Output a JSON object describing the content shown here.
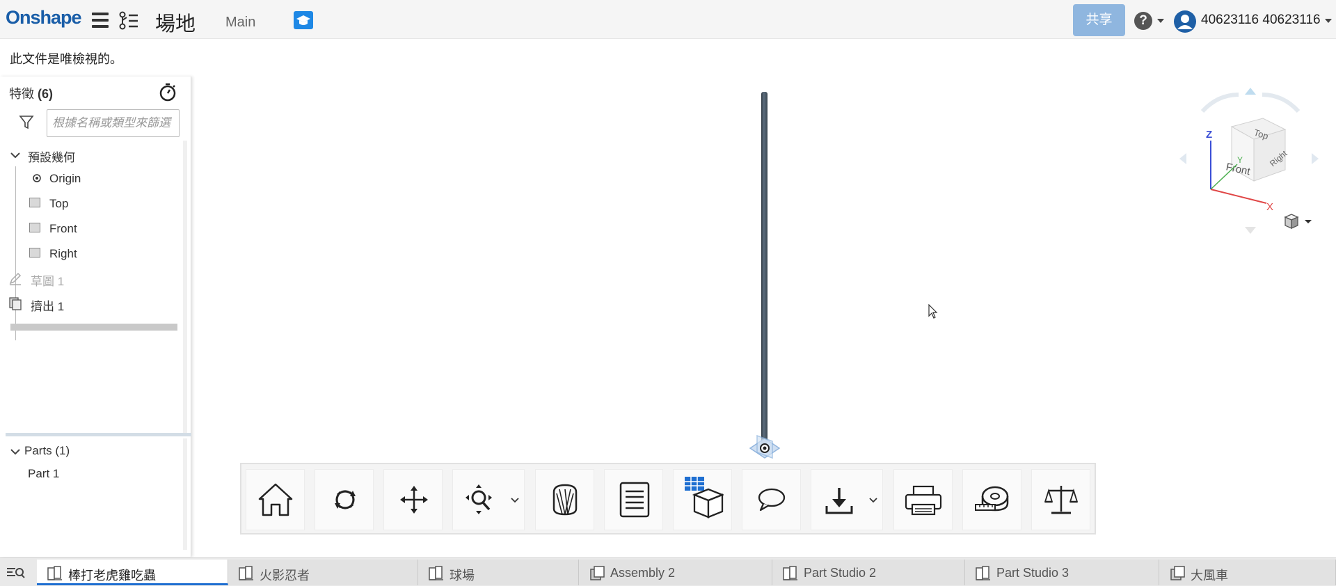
{
  "app": {
    "logo": "Onshape",
    "document_title": "場地",
    "branch": "Main",
    "share_label": "共享",
    "help_label": "?",
    "user_name": "40623116 40623116"
  },
  "banner": {
    "readonly_text": "此文件是唯檢視的。"
  },
  "feature_panel": {
    "title_prefix": "特徵",
    "title_count": "(6)",
    "filter_placeholder": "根據名稱或類型來篩選",
    "default_geometry_label": "預設幾何",
    "default_items": [
      {
        "label": "Origin",
        "icon": "origin-icon"
      },
      {
        "label": "Top",
        "icon": "plane-icon"
      },
      {
        "label": "Front",
        "icon": "plane-icon"
      },
      {
        "label": "Right",
        "icon": "plane-icon"
      }
    ],
    "features": [
      {
        "label": "草圖 1",
        "icon": "sketch-icon",
        "suppressed": true
      },
      {
        "label": "擠出 1",
        "icon": "extrude-icon",
        "suppressed": false
      }
    ],
    "parts_label": "Parts (1)",
    "parts": [
      "Part 1"
    ]
  },
  "viewcube": {
    "faces": [
      "Top",
      "Front",
      "Right"
    ],
    "axes": [
      "Z",
      "Y",
      "X"
    ]
  },
  "toolbar": {
    "buttons": [
      "home-icon",
      "rotate-icon",
      "pan-icon",
      "zoom-icon",
      "section-view-icon",
      "document-list-icon",
      "bom-table-icon",
      "comment-icon",
      "download-icon",
      "print-icon",
      "measure-icon",
      "mass-properties-icon"
    ]
  },
  "tabs": [
    {
      "label": "棒打老虎雞吃蟲",
      "icon": "part-studio-icon",
      "active": true
    },
    {
      "label": "火影忍者",
      "icon": "part-studio-icon",
      "active": false
    },
    {
      "label": "球場",
      "icon": "part-studio-icon",
      "active": false
    },
    {
      "label": "Assembly 2",
      "icon": "assembly-icon",
      "active": false
    },
    {
      "label": "Part Studio 2",
      "icon": "part-studio-icon",
      "active": false
    },
    {
      "label": "Part Studio 3",
      "icon": "part-studio-icon",
      "active": false
    },
    {
      "label": "大風車",
      "icon": "assembly-icon",
      "active": false
    }
  ],
  "colors": {
    "brand": "#1a5ea8",
    "share_button": "#8fb6df",
    "active_tab_underline": "#1f6fd1"
  }
}
